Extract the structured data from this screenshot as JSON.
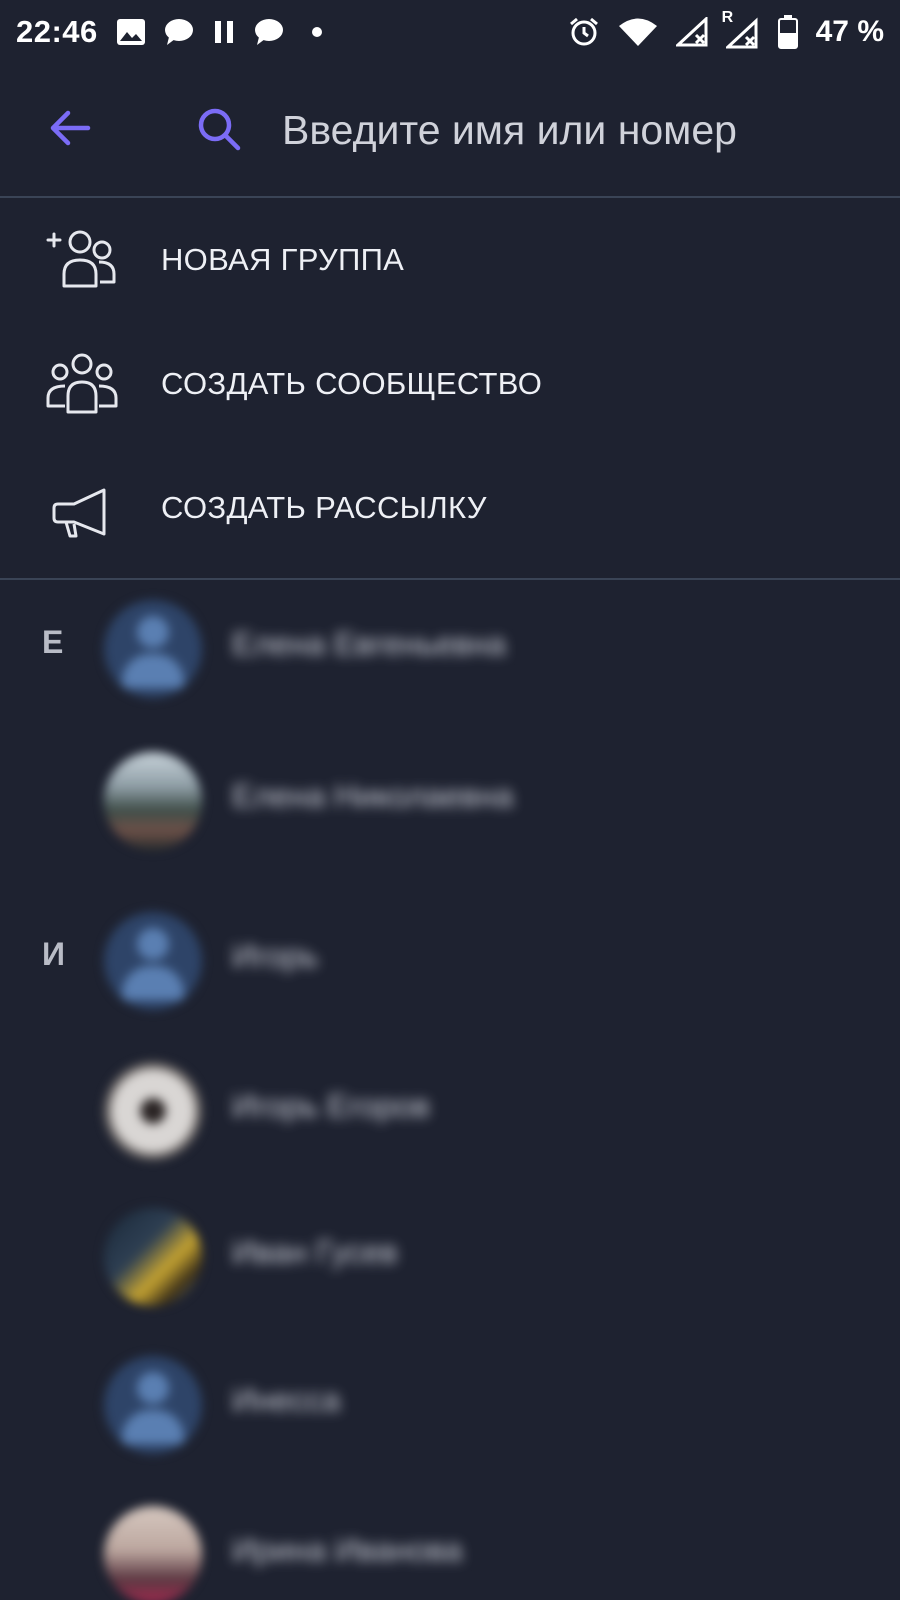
{
  "status_bar": {
    "time": "22:46",
    "battery_text": "47 %",
    "roaming_label": "R",
    "left_icons": [
      "image-icon",
      "message-bubble-icon",
      "pause-icon",
      "message-bubble-icon",
      "dot-icon"
    ],
    "right_icons": [
      "alarm-icon",
      "wifi-icon",
      "signal-icon",
      "signal-roaming-icon",
      "battery-icon"
    ]
  },
  "search": {
    "placeholder": "Введите имя или номер",
    "value": ""
  },
  "menu": {
    "items": [
      {
        "label": "НОВАЯ ГРУППА",
        "icon": "add-group-icon"
      },
      {
        "label": "СОЗДАТЬ СООБЩЕСТВО",
        "icon": "community-icon"
      },
      {
        "label": "СОЗДАТЬ РАССЫЛКУ",
        "icon": "megaphone-icon"
      }
    ]
  },
  "contacts": {
    "sections": [
      {
        "letter": "Е",
        "items": [
          {
            "name": "Елена Евгеньевна",
            "avatar": "default-avatar"
          },
          {
            "name": "Елена Николаевна",
            "avatar": "photo-avatar"
          }
        ]
      },
      {
        "letter": "И",
        "items": [
          {
            "name": "Игорь",
            "avatar": "default-avatar"
          },
          {
            "name": "Игорь Егоров",
            "avatar": "photo-avatar"
          },
          {
            "name": "Иван Гусев",
            "avatar": "photo-avatar"
          },
          {
            "name": "Инесса",
            "avatar": "default-avatar"
          },
          {
            "name": "Ирина Иванова",
            "avatar": "photo-avatar"
          }
        ]
      }
    ]
  },
  "colors": {
    "background": "#1e2230",
    "accent": "#7b6cf6",
    "divider": "#3a4456",
    "text_primary": "#eef0f5"
  }
}
